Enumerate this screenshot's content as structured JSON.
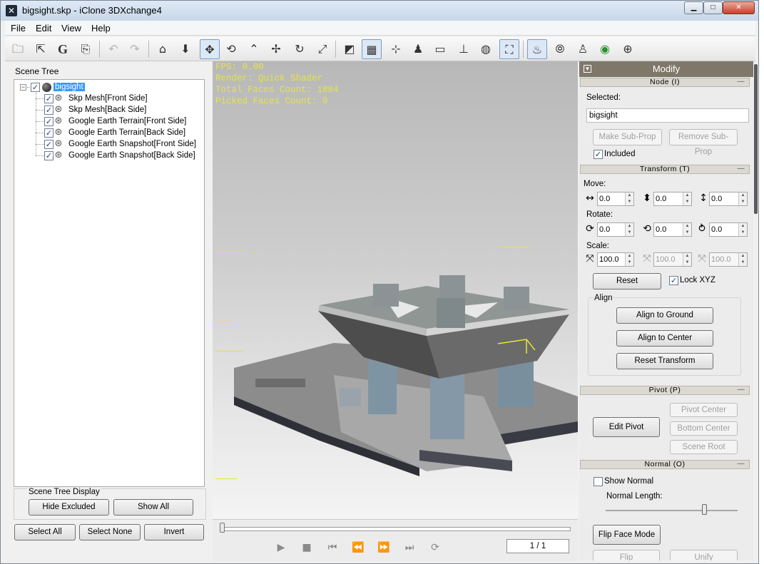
{
  "window": {
    "title": "bigsight.skp - iClone 3DXchange4",
    "min_label": "▁",
    "max_label": "□",
    "close_label": "✕"
  },
  "menu": [
    "File",
    "Edit",
    "View",
    "Help"
  ],
  "toolbar": {
    "icons": [
      "open-icon",
      "export-icon",
      "google-icon",
      "convert-icon",
      "undo-icon",
      "redo-icon",
      "home-view-icon",
      "drop-icon",
      "move-icon",
      "rotate-icon",
      "pick-icon",
      "pan-icon",
      "orbit-icon",
      "zoom-extent-icon",
      "box-icon",
      "grid-icon",
      "axis-icon",
      "character-icon",
      "plane-icon",
      "ground-icon",
      "globe-icon",
      "fit-icon",
      "light-icon",
      "camera-icon",
      "actor-icon",
      "color-icon",
      "sphere-icon"
    ],
    "google_glyph": "G"
  },
  "scene_tree": {
    "title": "Scene Tree",
    "root": "bigsight",
    "children": [
      "Skp Mesh[Front Side]",
      "Skp Mesh[Back Side]",
      "Google Earth Terrain[Front Side]",
      "Google Earth Terrain[Back Side]",
      "Google Earth Snapshot[Front Side]",
      "Google Earth Snapshot[Back Side]"
    ],
    "display_title": "Scene Tree Display",
    "hide_excluded": "Hide Excluded",
    "show_all": "Show All",
    "select_all": "Select All",
    "select_none": "Select None",
    "invert": "Invert"
  },
  "viewport": {
    "fps": "FPS: 0.00",
    "render": "Render: Quick Shader",
    "total_faces": "Total Faces Count: 1884",
    "picked_faces": "Picked Faces Count: 0"
  },
  "timeline": {
    "frame": "1 / 1",
    "progress": 0
  },
  "modify": {
    "title": "Modify",
    "node": {
      "header": "Node (I)",
      "selected_label": "Selected:",
      "selected_value": "bigsight",
      "make_sub_prop": "Make Sub-Prop",
      "remove_sub_prop": "Remove Sub-Prop",
      "included": "Included"
    },
    "transform": {
      "header": "Transform (T)",
      "move_label": "Move:",
      "move": [
        "0.0",
        "0.0",
        "0.0"
      ],
      "rotate_label": "Rotate:",
      "rotate": [
        "0.0",
        "0.0",
        "0.0"
      ],
      "scale_label": "Scale:",
      "scale": [
        "100.0",
        "100.0",
        "100.0"
      ],
      "reset": "Reset",
      "lock_xyz": "Lock XYZ",
      "align_label": "Align",
      "align_ground": "Align to Ground",
      "align_center": "Align to Center",
      "reset_transform": "Reset Transform"
    },
    "pivot": {
      "header": "Pivot (P)",
      "edit_pivot": "Edit Pivot",
      "pivot_center": "Pivot Center",
      "bottom_center": "Bottom Center",
      "scene_root": "Scene Root"
    },
    "normal": {
      "header": "Normal (O)",
      "show_normal": "Show Normal",
      "normal_length": "Normal Length:",
      "normal_length_level": 0.75,
      "flip_face_mode": "Flip Face Mode",
      "flip": "Flip",
      "unify": "Unify"
    }
  },
  "colors": {
    "hud": "#e4e44a",
    "modify_header": "#7f776a",
    "selection": "#3399ff"
  }
}
